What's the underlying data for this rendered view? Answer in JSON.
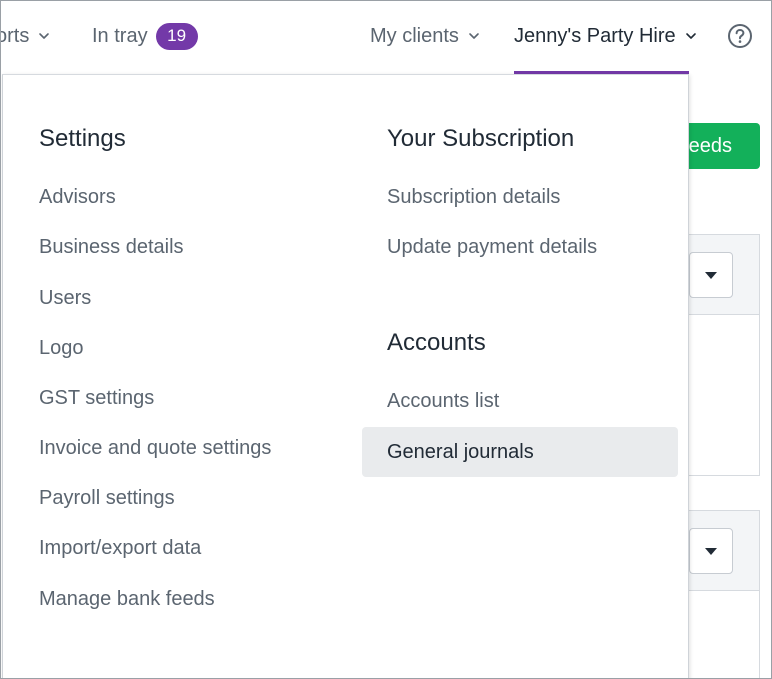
{
  "nav": {
    "reports_label": "orts",
    "in_tray_label": "In tray",
    "in_tray_count": "19",
    "my_clients_label": "My clients",
    "org_label": "Jenny's Party Hire"
  },
  "background": {
    "green_button_label": "eeds"
  },
  "menu": {
    "settings": {
      "title": "Settings",
      "items": [
        "Advisors",
        "Business details",
        "Users",
        "Logo",
        "GST settings",
        "Invoice and quote settings",
        "Payroll settings",
        "Import/export data",
        "Manage bank feeds"
      ]
    },
    "subscription": {
      "title": "Your Subscription",
      "items": [
        "Subscription details",
        "Update payment details"
      ]
    },
    "accounts": {
      "title": "Accounts",
      "items": [
        "Accounts list",
        "General journals"
      ],
      "active_item": "General journals"
    }
  },
  "colors": {
    "accent_purple": "#7339a8",
    "green_button": "#13b05a",
    "hover_bg": "#e9ebed"
  },
  "icons": {
    "help": "question-circle-icon",
    "chevron": "chevron-down-icon"
  }
}
